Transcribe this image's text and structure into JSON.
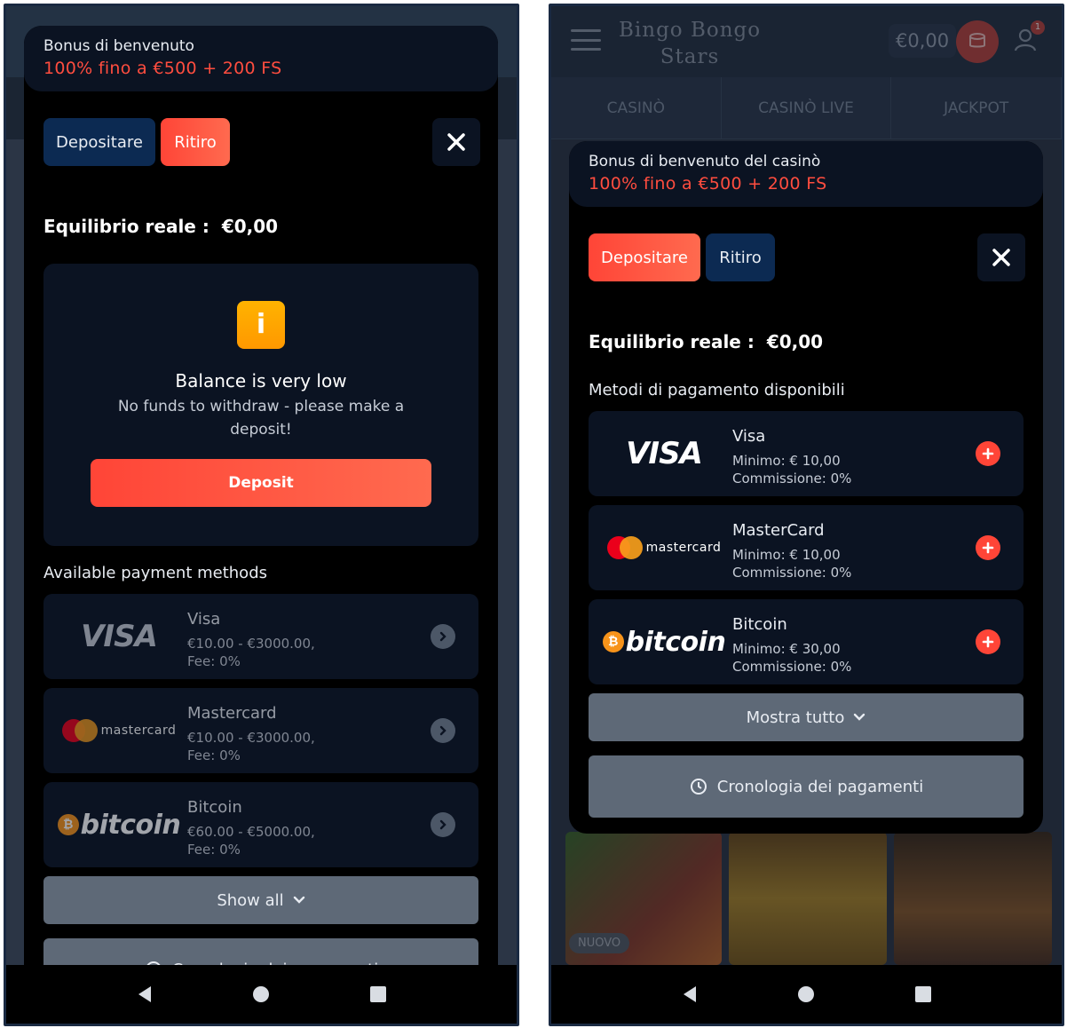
{
  "left": {
    "bonus": {
      "title": "Bonus di benvenuto",
      "offer": "100% fino a €500 + 200 FS"
    },
    "buttons": {
      "deposit": "Depositare",
      "withdraw": "Ritiro"
    },
    "balance": {
      "label": "Equilibrio reale :",
      "value": "€0,00"
    },
    "notice": {
      "title": "Balance is very low",
      "text": "No funds to withdraw - please make a deposit!",
      "cta": "Deposit"
    },
    "methods_title": "Available payment methods",
    "methods": [
      {
        "name": "Visa",
        "range": "€10.00 - €3000.00,",
        "fee": "Fee: 0%"
      },
      {
        "name": "Mastercard",
        "range": "€10.00 - €3000.00,",
        "fee": "Fee: 0%"
      },
      {
        "name": "Bitcoin",
        "range": "€60.00 - €5000.00,",
        "fee": "Fee: 0%"
      }
    ],
    "show_all": "Show all",
    "history": "Cronologia dei pagamenti"
  },
  "right": {
    "header": {
      "logo_line1": "Bingo Bongo",
      "logo_line2": "Stars",
      "balance": "€0,00",
      "badge": "1"
    },
    "nav": [
      "CASINÒ",
      "CASINÒ LIVE",
      "JACKPOT"
    ],
    "bonus": {
      "title": "Bonus di benvenuto del casinò",
      "offer": "100% fino a €500 + 200 FS"
    },
    "buttons": {
      "deposit": "Depositare",
      "withdraw": "Ritiro"
    },
    "balance": {
      "label": "Equilibrio reale :",
      "value": "€0,00"
    },
    "methods_title": "Metodi di pagamento disponibili",
    "methods": [
      {
        "name": "Visa",
        "min": "Minimo: € 10,00",
        "fee": "Commissione: 0%"
      },
      {
        "name": "MasterCard",
        "min": "Minimo: € 10,00",
        "fee": "Commissione: 0%"
      },
      {
        "name": "Bitcoin",
        "min": "Minimo: € 30,00",
        "fee": "Commissione: 0%"
      }
    ],
    "show_all": "Mostra tutto",
    "history": "Cronologia dei pagamenti",
    "game_badge": "NUOVO"
  },
  "logos": {
    "visa": "VISA",
    "mastercard": "mastercard",
    "bitcoin": "bitcoin",
    "bitcoin_symbol": "₿",
    "info_symbol": "i"
  },
  "colors": {
    "accent_red": "#ff4537",
    "navy": "#0c2a52",
    "modal_bg": "#000000",
    "card_bg": "#0b1322",
    "warning": "#ff9800"
  },
  "icons": [
    "close-icon",
    "info-icon",
    "chevron-right-icon",
    "plus-icon",
    "chevron-down-icon",
    "history-icon",
    "back-icon",
    "home-icon",
    "recents-icon",
    "menu-icon",
    "wallet-icon",
    "user-icon"
  ]
}
